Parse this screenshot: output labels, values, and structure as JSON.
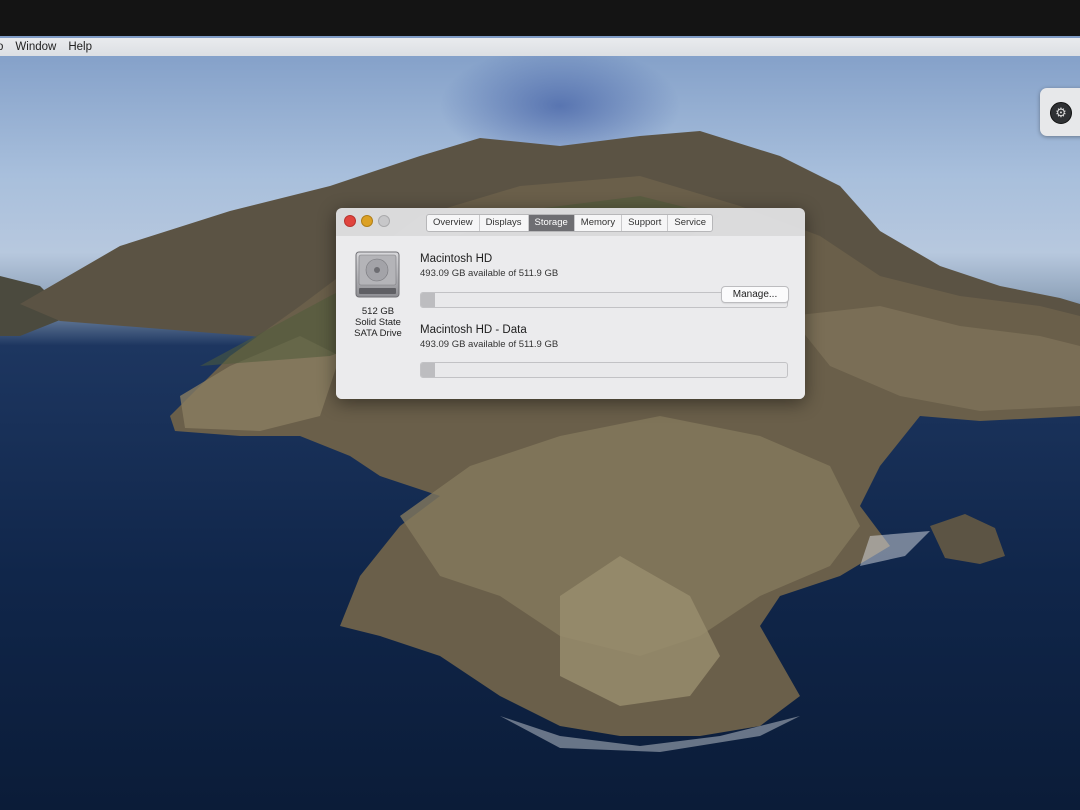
{
  "menubar": {
    "items": [
      "o",
      "Window",
      "Help"
    ]
  },
  "widget": {
    "icon": "system-preferences-icon"
  },
  "window": {
    "tabs": [
      {
        "label": "Overview",
        "active": false
      },
      {
        "label": "Displays",
        "active": false
      },
      {
        "label": "Storage",
        "active": true
      },
      {
        "label": "Memory",
        "active": false
      },
      {
        "label": "Support",
        "active": false
      },
      {
        "label": "Service",
        "active": false
      }
    ],
    "disk": {
      "icon": "hard-drive-icon",
      "capacity": "512 GB",
      "type": "Solid State",
      "interface": "SATA Drive"
    },
    "volumes": [
      {
        "name": "Macintosh HD",
        "available": "493.09 GB available of 511.9 GB",
        "used_fraction": 0.037
      },
      {
        "name": "Macintosh HD - Data",
        "available": "493.09 GB available of 511.9 GB",
        "used_fraction": 0.037
      }
    ],
    "manage_label": "Manage..."
  },
  "colors": {
    "close": "#e0443e",
    "minimize": "#dca124",
    "active_tab": "#6e6e72"
  }
}
